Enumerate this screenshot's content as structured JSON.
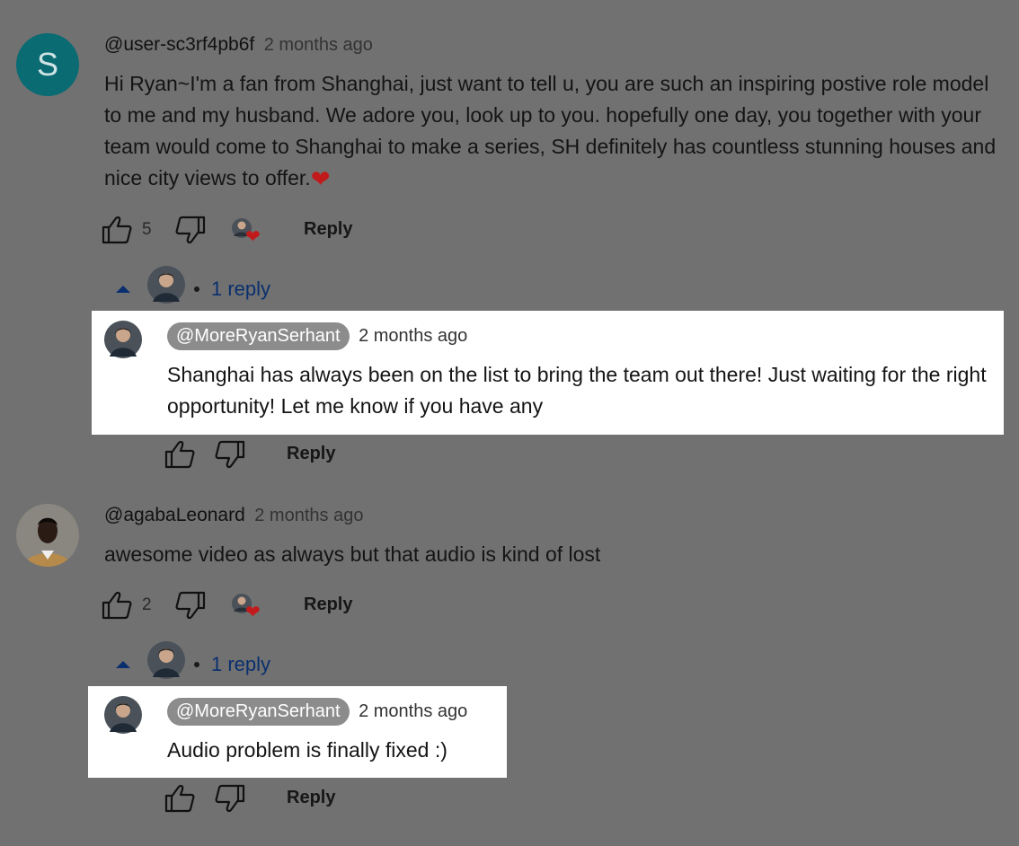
{
  "comments": [
    {
      "avatar_letter": "S",
      "author": "@user-sc3rf4pb6f",
      "time": "2 months ago",
      "text": "Hi Ryan~I'm a fan from Shanghai, just want to tell u, you are such an inspiring postive role model to me and my husband. We adore you, look up to you. hopefully one day, you together with your team would come to Shanghai to make a series, SH definitely has countless stunning houses and nice city views to offer.",
      "like_count": "5",
      "reply_label": "Reply",
      "replies_label": "1 reply",
      "reply": {
        "author": "@MoreRyanSerhant",
        "time": "2 months ago",
        "text": "Shanghai has always been on the list to bring the team out there! Just waiting for the right opportunity! Let me know if you have any",
        "reply_label": "Reply"
      }
    },
    {
      "author": "@agabaLeonard",
      "time": "2 months ago",
      "text": "awesome video as always but that audio is kind of lost",
      "like_count": "2",
      "reply_label": "Reply",
      "replies_label": "1 reply",
      "reply": {
        "author": "@MoreRyanSerhant",
        "time": "2 months ago",
        "text": "Audio problem is finally fixed :)",
        "reply_label": "Reply"
      }
    }
  ],
  "icons": {
    "like": "thumbs-up-icon",
    "dislike": "thumbs-down-icon",
    "heart": "heart-icon",
    "caret": "caret-up-icon"
  },
  "colors": {
    "background": "#717171",
    "highlight": "#ffffff",
    "link": "#0a2f6e",
    "heart": "#c21a1a",
    "avatar_s": "#0a6b73"
  }
}
